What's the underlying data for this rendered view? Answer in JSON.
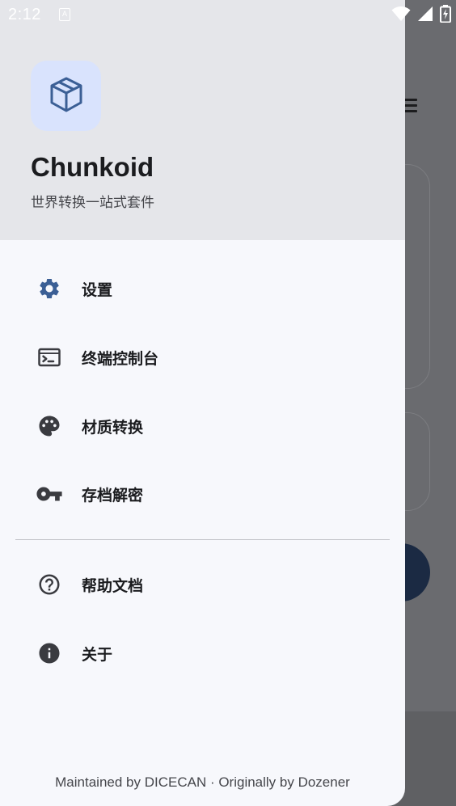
{
  "status_bar": {
    "time": "2:12",
    "notification_glyph": "A",
    "icons": [
      "wifi-icon",
      "signal-icon",
      "battery-charging-icon"
    ]
  },
  "drawer": {
    "app_logo_icon": "cube-box-icon",
    "app_name": "Chunkoid",
    "app_subtitle": "世界转换一站式套件",
    "items": [
      {
        "label": "设置",
        "icon": "gear-icon"
      },
      {
        "label": "终端控制台",
        "icon": "terminal-icon"
      },
      {
        "label": "材质转换",
        "icon": "palette-icon"
      },
      {
        "label": "存档解密",
        "icon": "key-icon"
      },
      {
        "label": "帮助文档",
        "icon": "help-circle-icon"
      },
      {
        "label": "关于",
        "icon": "info-icon"
      }
    ],
    "footer": "Maintained by DICECAN · Originally by Dozener"
  },
  "colors": {
    "accent": "#3b5f95",
    "header_bg": "#e5e6ea",
    "drawer_bg": "#f7f8fc",
    "logo_bg": "#d9e3fd",
    "scrim": "#6a6b6f"
  }
}
